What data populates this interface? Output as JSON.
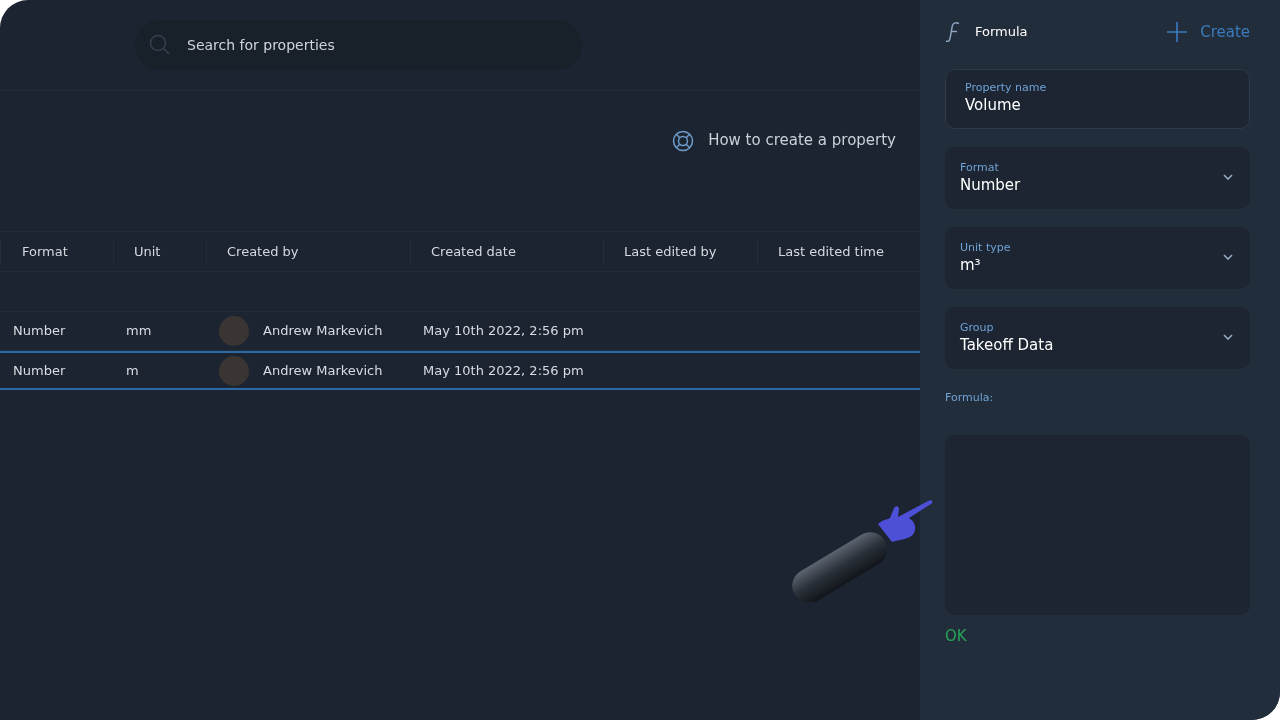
{
  "search": {
    "placeholder": "Search for properties"
  },
  "help_link": "How to create a property",
  "table": {
    "columns": [
      "Format",
      "Unit",
      "Created by",
      "Created date",
      "Last edited by",
      "Last edited time"
    ],
    "rows": [
      {
        "format": "Number",
        "unit": "mm",
        "created_by": "Andrew Markevich",
        "created_date": "May 10th 2022, 2:56 pm",
        "selected": false
      },
      {
        "format": "Number",
        "unit": "m",
        "created_by": "Andrew Markevich",
        "created_date": "May 10th 2022, 2:56 pm",
        "selected": true
      }
    ]
  },
  "panel": {
    "title": "Formula",
    "create_button": "Create",
    "fields": [
      {
        "kind": "input",
        "label": "Property name",
        "value": "Volume"
      },
      {
        "kind": "select",
        "label": "Format",
        "value": "Number"
      },
      {
        "kind": "select",
        "label": "Unit type",
        "value": "m³"
      },
      {
        "kind": "select",
        "label": "Group",
        "value": "Takeoff Data"
      }
    ],
    "formula_label": "Formula:",
    "ok_button": "OK"
  }
}
